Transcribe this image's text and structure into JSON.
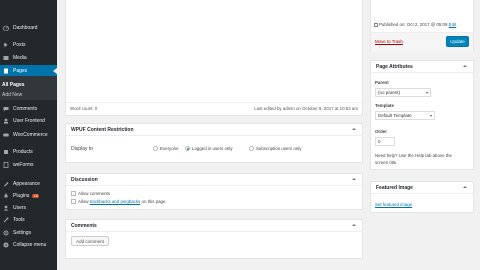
{
  "sidebar": {
    "items": [
      {
        "label": "Dashboard",
        "icon": "dashboard-icon"
      },
      {
        "label": "Posts",
        "icon": "pin-icon"
      },
      {
        "label": "Media",
        "icon": "media-icon"
      },
      {
        "label": "Pages",
        "icon": "pages-icon"
      },
      {
        "label": "Comments",
        "icon": "comments-icon"
      },
      {
        "label": "User Frontend",
        "icon": "user-frontend-icon"
      },
      {
        "label": "WooCommerce",
        "icon": "woocommerce-icon"
      },
      {
        "label": "Products",
        "icon": "products-icon"
      },
      {
        "label": "weForms",
        "icon": "weforms-icon"
      },
      {
        "label": "Appearance",
        "icon": "appearance-icon"
      },
      {
        "label": "Plugins",
        "icon": "plugins-icon",
        "badge": "16"
      },
      {
        "label": "Users",
        "icon": "users-icon"
      },
      {
        "label": "Tools",
        "icon": "tools-icon"
      },
      {
        "label": "Settings",
        "icon": "settings-icon"
      },
      {
        "label": "Collapse menu",
        "icon": "collapse-icon"
      }
    ],
    "submenu": [
      "All Pages",
      "Add New"
    ]
  },
  "editor": {
    "word_count": "Word count: 0",
    "last_edited": "Last edited by admin on October 9, 2017 at 10:53 am"
  },
  "restriction": {
    "title": "WPUF Content Restriction",
    "display_to_label": "Display to",
    "options": [
      "Everyone",
      "Logged in users only",
      "Subscription users only"
    ]
  },
  "discussion": {
    "title": "Discussion",
    "allow_comments": "Allow comments",
    "allow_prefix": "Allow",
    "trackbacks_link": "trackbacks and pingbacks",
    "allow_suffix": "on this page."
  },
  "comments": {
    "title": "Comments",
    "add_button": "Add comment"
  },
  "publish": {
    "published_on": "Published on: Oct 2, 2017 @ 05:09",
    "edit_link": "Edit",
    "trash_link": "Move to Trash",
    "update_button": "Update"
  },
  "page_attributes": {
    "title": "Page Attributes",
    "parent_label": "Parent",
    "parent_value": "(no parent)",
    "template_label": "Template",
    "template_value": "Default Template",
    "order_label": "Order",
    "order_value": "0",
    "help_text_1": "Need help? Use the Help tab above the",
    "help_text_2": "screen title."
  },
  "featured_image": {
    "title": "Featured Image",
    "set_link": "Set featured image"
  },
  "colors": {
    "sidebar_bg": "#23282d",
    "active": "#0073aa",
    "primary_button": "#0085ba"
  }
}
